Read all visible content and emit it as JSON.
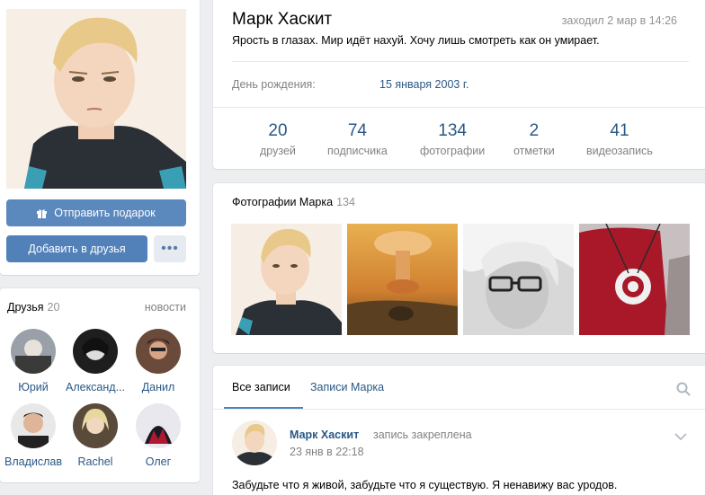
{
  "profile": {
    "name": "Марк Хаскит",
    "last_seen": "заходил 2 мар в 14:26",
    "status": "Ярость в глазах. Мир идёт нахуй. Хочу лишь смотреть как он умирает.",
    "birthday_label": "День рождения:",
    "birthday_value": "15 января 2003 г."
  },
  "actions": {
    "gift": "Отправить подарок",
    "add_friend": "Добавить в друзья",
    "more": "•••"
  },
  "counters": [
    {
      "num": "20",
      "label": "друзей"
    },
    {
      "num": "74",
      "label": "подписчика"
    },
    {
      "num": "134",
      "label": "фотографии"
    },
    {
      "num": "2",
      "label": "отметки"
    },
    {
      "num": "41",
      "label": "видеозапись"
    }
  ],
  "friends": {
    "title": "Друзья",
    "count": "20",
    "news_link": "новости",
    "items": [
      {
        "name": "Юрий"
      },
      {
        "name": "Александ..."
      },
      {
        "name": "Данил"
      },
      {
        "name": "Владислав"
      },
      {
        "name": "Rachel"
      },
      {
        "name": "Олег"
      }
    ]
  },
  "photos": {
    "title": "Фотографии Марка",
    "count": "134"
  },
  "wall": {
    "tab_all": "Все записи",
    "tab_mark": "Записи Марка",
    "post": {
      "author": "Марк Хаскит",
      "pinned": "запись закреплена",
      "date": "23 янв в 22:18",
      "text": "Забудьте что я живой, забудьте что я существую. Я ненавижу вас уродов."
    }
  },
  "colors": {
    "accent": "#5181b8",
    "link": "#2a5885",
    "muted": "#828282",
    "background": "#edeef0"
  }
}
